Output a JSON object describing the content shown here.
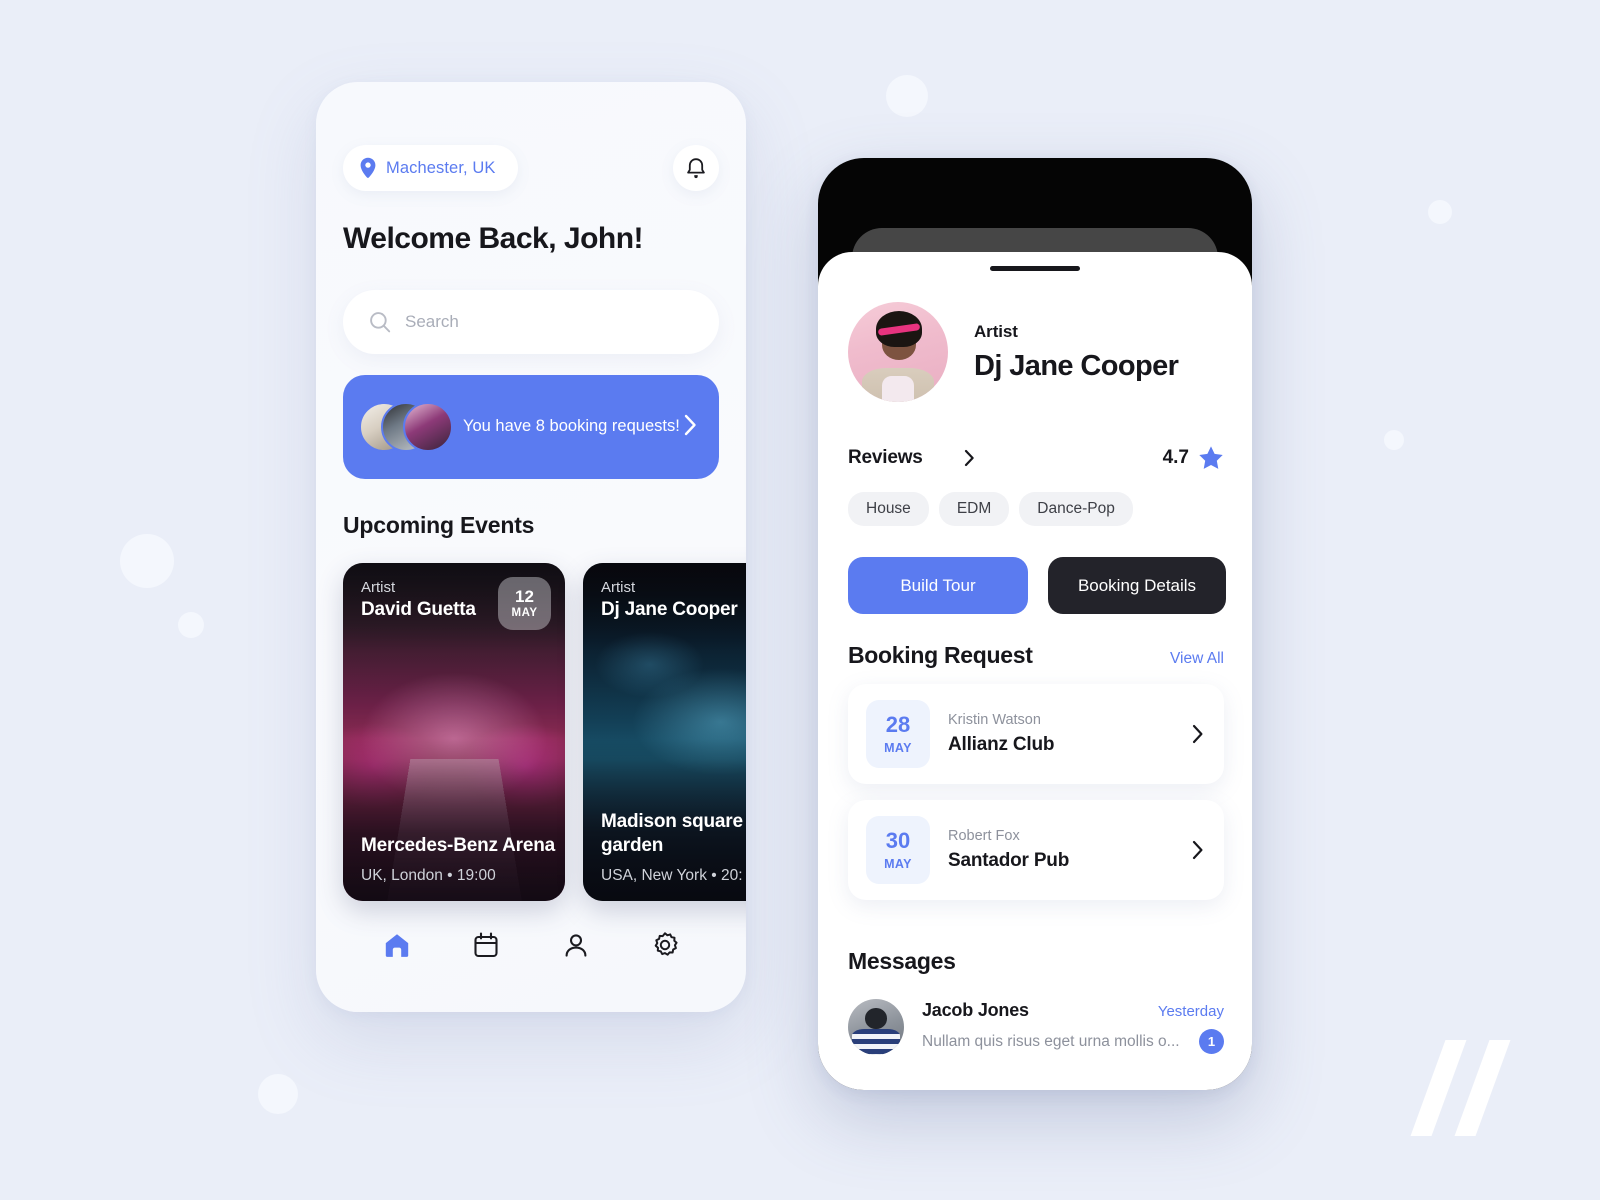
{
  "theme": {
    "accent": "#5b7bf0",
    "dark": "#23232a",
    "page_background": "#eaeef8",
    "muted_text": "#8d919c"
  },
  "phone_home": {
    "location_pill": {
      "icon": "location-pin-icon",
      "label": "Machester, UK"
    },
    "notification_button": {
      "icon": "bell-icon"
    },
    "welcome_title": "Welcome Back, John!",
    "search": {
      "icon": "search-icon",
      "placeholder": "Search",
      "value": ""
    },
    "banner": {
      "text": "You have 8 booking requests!",
      "chevron": "chevron-right-icon",
      "avatar_count": 3
    },
    "section_title": "Upcoming Events",
    "events": [
      {
        "role_label": "Artist",
        "artist": "David Guetta",
        "date_day": "12",
        "date_month": "MAY",
        "venue": "Mercedes-Benz Arena",
        "meta": "UK, London  •  19:00"
      },
      {
        "role_label": "Artist",
        "artist": "Dj Jane Cooper",
        "date_day": "",
        "date_month": "",
        "venue": "Madison square garden",
        "meta": "USA, New York  •  20:"
      }
    ],
    "nav": [
      {
        "icon": "home-icon",
        "active": true
      },
      {
        "icon": "calendar-icon",
        "active": false
      },
      {
        "icon": "person-icon",
        "active": false
      },
      {
        "icon": "gear-icon",
        "active": false
      }
    ]
  },
  "phone_artist": {
    "sheet_handle": "drag-handle",
    "profile": {
      "avatar": "artist-avatar",
      "role_label": "Artist",
      "name": "Dj Jane Cooper"
    },
    "reviews": {
      "label": "Reviews",
      "chevron": "chevron-right-icon",
      "rating": "4.7",
      "star_icon": "star-icon"
    },
    "tags": [
      "House",
      "EDM",
      "Dance-Pop"
    ],
    "actions": {
      "primary_label": "Build Tour",
      "secondary_label": "Booking Details"
    },
    "booking_section": {
      "title": "Booking Request",
      "view_all_label": "View All",
      "requests": [
        {
          "date_day": "28",
          "date_month": "MAY",
          "person": "Kristin Watson",
          "venue": "Allianz Club",
          "chevron": "chevron-right-icon"
        },
        {
          "date_day": "30",
          "date_month": "MAY",
          "person": "Robert Fox",
          "venue": "Santador Pub",
          "chevron": "chevron-right-icon"
        }
      ]
    },
    "messages_section": {
      "title": "Messages",
      "items": [
        {
          "avatar": "contact-avatar",
          "name": "Jacob Jones",
          "timestamp": "Yesterday",
          "preview": "Nullam quis risus eget urna mollis o...",
          "unread_count": "1"
        }
      ]
    }
  }
}
